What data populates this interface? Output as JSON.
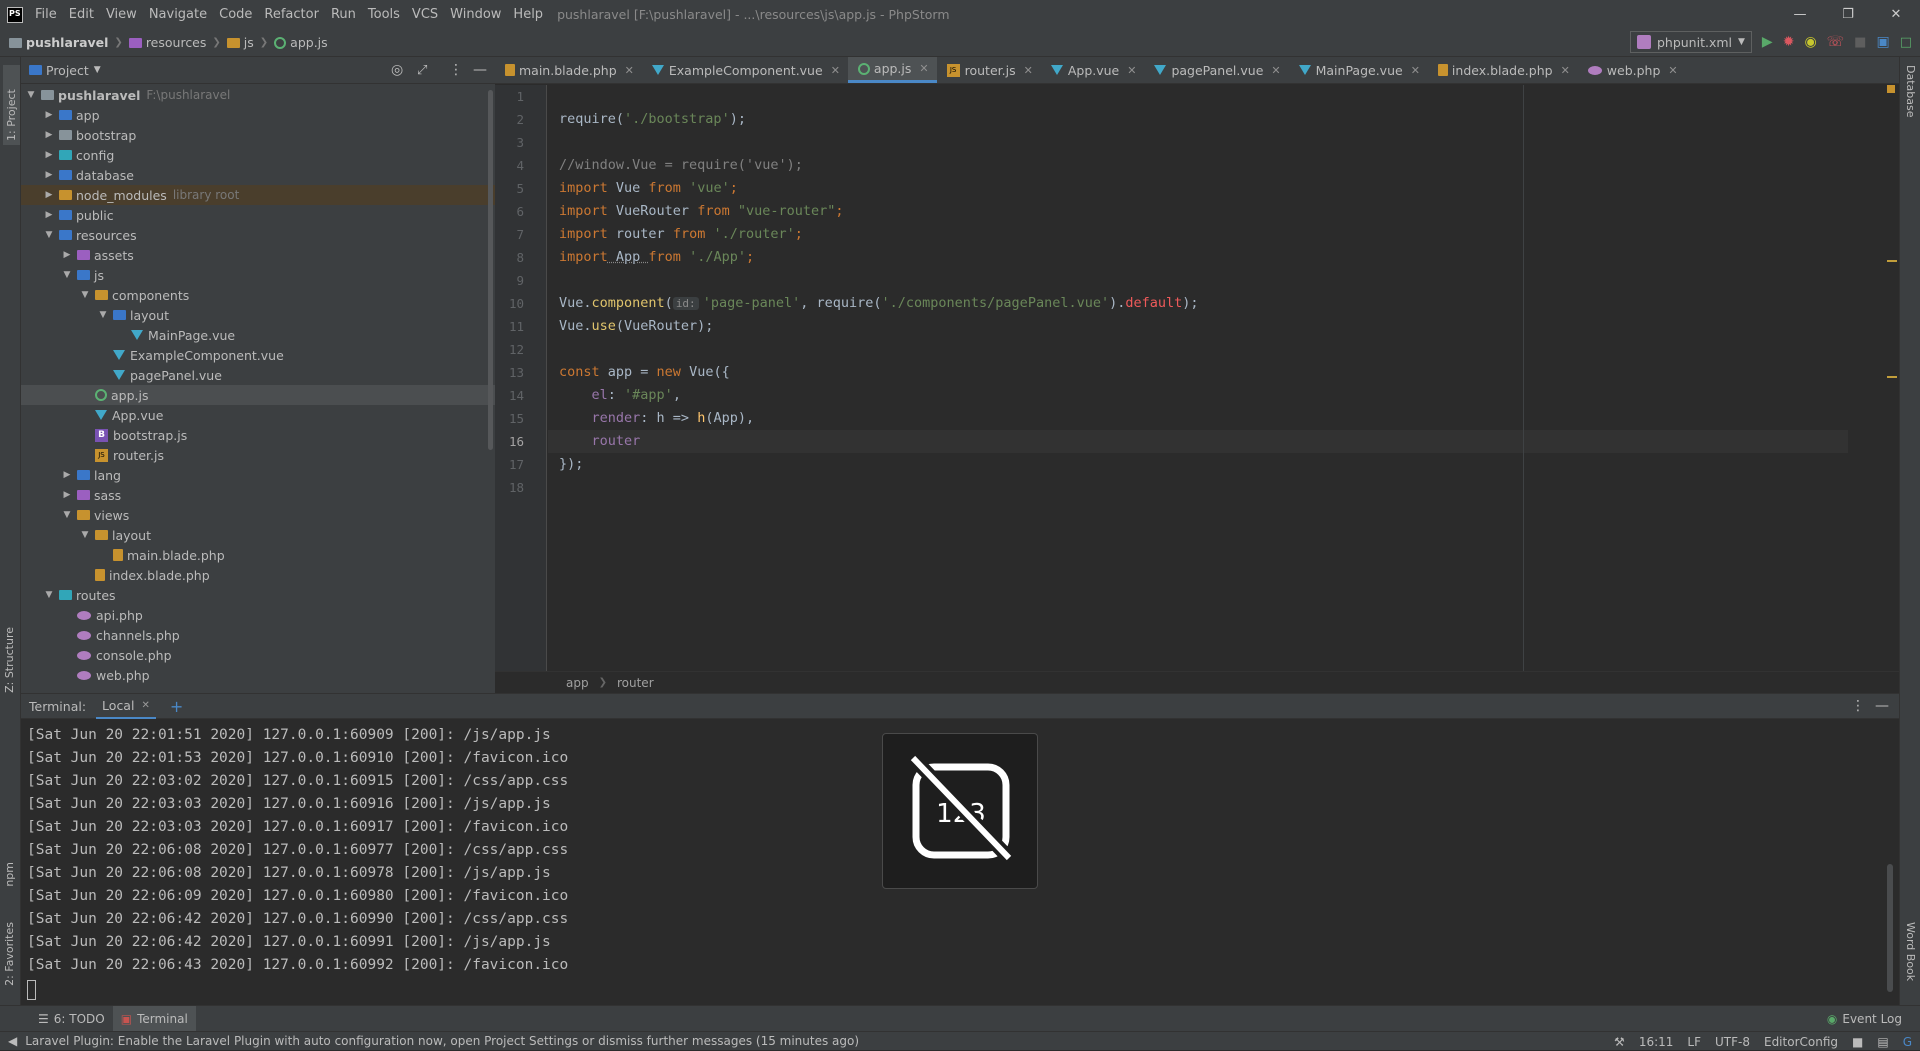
{
  "window": {
    "title": "pushlaravel [F:\\pushlaravel] - ...\\resources\\js\\app.js - PhpStorm",
    "menu": [
      "File",
      "Edit",
      "View",
      "Navigate",
      "Code",
      "Refactor",
      "Run",
      "Tools",
      "VCS",
      "Window",
      "Help"
    ]
  },
  "breadcrumbs": [
    "pushlaravel",
    "resources",
    "js",
    "app.js"
  ],
  "toolbar": {
    "run_config": "phpunit.xml"
  },
  "left_strip": {
    "project": "1: Project",
    "structure": "Z: Structure",
    "npm": "npm",
    "favorites": "2: Favorites"
  },
  "right_strip": {
    "database": "Database",
    "wordbook": "Word Book"
  },
  "project_panel": {
    "title": "Project",
    "tree": [
      {
        "label": "pushlaravel",
        "hint": "F:\\pushlaravel",
        "depth": 0,
        "arrow": "down",
        "icon": "folder"
      },
      {
        "label": "app",
        "depth": 1,
        "arrow": "right",
        "icon": "folder-blue"
      },
      {
        "label": "bootstrap",
        "depth": 1,
        "arrow": "right",
        "icon": "folder"
      },
      {
        "label": "config",
        "depth": 1,
        "arrow": "right",
        "icon": "folder-teal"
      },
      {
        "label": "database",
        "depth": 1,
        "arrow": "right",
        "icon": "folder-blue"
      },
      {
        "label": "node_modules",
        "hint": "library root",
        "depth": 1,
        "arrow": "right",
        "icon": "folder-orange",
        "nm": true
      },
      {
        "label": "public",
        "depth": 1,
        "arrow": "right",
        "icon": "folder-blue"
      },
      {
        "label": "resources",
        "depth": 1,
        "arrow": "down",
        "icon": "folder-blue"
      },
      {
        "label": "assets",
        "depth": 2,
        "arrow": "right",
        "icon": "folder-purple"
      },
      {
        "label": "js",
        "depth": 2,
        "arrow": "down",
        "icon": "folder-blue"
      },
      {
        "label": "components",
        "depth": 3,
        "arrow": "down",
        "icon": "folder-orange"
      },
      {
        "label": "layout",
        "depth": 4,
        "arrow": "down",
        "icon": "folder-blue"
      },
      {
        "label": "MainPage.vue",
        "depth": 5,
        "arrow": "",
        "icon": "vue"
      },
      {
        "label": "ExampleComponent.vue",
        "depth": 4,
        "arrow": "",
        "icon": "vue"
      },
      {
        "label": "pagePanel.vue",
        "depth": 4,
        "arrow": "",
        "icon": "vue"
      },
      {
        "label": "app.js",
        "depth": 3,
        "arrow": "",
        "icon": "js",
        "selected": true
      },
      {
        "label": "App.vue",
        "depth": 3,
        "arrow": "",
        "icon": "vue"
      },
      {
        "label": "bootstrap.js",
        "depth": 3,
        "arrow": "",
        "icon": "bootstrap"
      },
      {
        "label": "router.js",
        "depth": 3,
        "arrow": "",
        "icon": "router"
      },
      {
        "label": "lang",
        "depth": 2,
        "arrow": "right",
        "icon": "folder-blue"
      },
      {
        "label": "sass",
        "depth": 2,
        "arrow": "right",
        "icon": "folder-purple"
      },
      {
        "label": "views",
        "depth": 2,
        "arrow": "down",
        "icon": "folder-orange"
      },
      {
        "label": "layout",
        "depth": 3,
        "arrow": "down",
        "icon": "folder-orange"
      },
      {
        "label": "main.blade.php",
        "depth": 4,
        "arrow": "",
        "icon": "blade"
      },
      {
        "label": "index.blade.php",
        "depth": 3,
        "arrow": "",
        "icon": "blade"
      },
      {
        "label": "routes",
        "depth": 1,
        "arrow": "down",
        "icon": "folder-teal"
      },
      {
        "label": "api.php",
        "depth": 2,
        "arrow": "",
        "icon": "php"
      },
      {
        "label": "channels.php",
        "depth": 2,
        "arrow": "",
        "icon": "php"
      },
      {
        "label": "console.php",
        "depth": 2,
        "arrow": "",
        "icon": "php"
      },
      {
        "label": "web.php",
        "depth": 2,
        "arrow": "",
        "icon": "php"
      }
    ]
  },
  "editor": {
    "tabs": [
      {
        "label": "main.blade.php",
        "icon": "blade"
      },
      {
        "label": "ExampleComponent.vue",
        "icon": "vue"
      },
      {
        "label": "app.js",
        "icon": "js",
        "active": true
      },
      {
        "label": "router.js",
        "icon": "router"
      },
      {
        "label": "App.vue",
        "icon": "vue"
      },
      {
        "label": "pagePanel.vue",
        "icon": "vue"
      },
      {
        "label": "MainPage.vue",
        "icon": "vue"
      },
      {
        "label": "index.blade.php",
        "icon": "blade"
      },
      {
        "label": "web.php",
        "icon": "php"
      }
    ],
    "line_numbers": [
      "1",
      "2",
      "3",
      "4",
      "5",
      "6",
      "7",
      "8",
      "9",
      "10",
      "11",
      "12",
      "13",
      "14",
      "15",
      "16",
      "17",
      "18"
    ],
    "current_line": 16,
    "code": {
      "l2a": "require(",
      "l2b": "'./bootstrap'",
      "l2c": ");",
      "l4": "//window.Vue = require('vue');",
      "l5a": "import",
      "l5b": " Vue ",
      "l5c": "from",
      "l5d": " 'vue'",
      "l5e": ";",
      "l6a": "import",
      "l6b": " VueRouter ",
      "l6c": "from",
      "l6d": " \"vue-router\"",
      "l6e": ";",
      "l7a": "import",
      "l7b": " router ",
      "l7c": "from",
      "l7d": " './router'",
      "l7e": ";",
      "l8a": "import",
      "l8b": " App ",
      "l8c": "from",
      "l8d": " './App'",
      "l8e": ";",
      "l10a": "Vue.",
      "l10b": "component",
      "l10c": "(",
      "l10hint": "id:",
      "l10d": "'page-panel'",
      "l10e": ", require(",
      "l10f": "'./components/pagePanel.vue'",
      "l10g": ").",
      "l10h": "default",
      "l10i": ");",
      "l11a": "Vue.",
      "l11b": "use",
      "l11c": "(VueRouter);",
      "l13a": "const",
      "l13b": " app = ",
      "l13c": "new",
      "l13d": " Vue({",
      "l14a": "    el",
      "l14b": ": ",
      "l14c": "'#app'",
      "l14d": ",",
      "l15a": "    render",
      "l15b": ": h => ",
      "l15c": "h",
      "l15d": "(App),",
      "l16": "    router",
      "l17": "});"
    },
    "breadcrumb": [
      "app",
      "router"
    ]
  },
  "terminal": {
    "label": "Terminal:",
    "tab": "Local",
    "lines": [
      "[Sat Jun 20 22:01:51 2020] 127.0.0.1:60909 [200]: /js/app.js",
      "[Sat Jun 20 22:01:53 2020] 127.0.0.1:60910 [200]: /favicon.ico",
      "[Sat Jun 20 22:03:02 2020] 127.0.0.1:60915 [200]: /css/app.css",
      "[Sat Jun 20 22:03:03 2020] 127.0.0.1:60916 [200]: /js/app.js",
      "[Sat Jun 20 22:03:03 2020] 127.0.0.1:60917 [200]: /favicon.ico",
      "[Sat Jun 20 22:06:08 2020] 127.0.0.1:60977 [200]: /css/app.css",
      "[Sat Jun 20 22:06:08 2020] 127.0.0.1:60978 [200]: /js/app.js",
      "[Sat Jun 20 22:06:09 2020] 127.0.0.1:60980 [200]: /favicon.ico",
      "[Sat Jun 20 22:06:42 2020] 127.0.0.1:60990 [200]: /css/app.css",
      "[Sat Jun 20 22:06:42 2020] 127.0.0.1:60991 [200]: /js/app.js",
      "[Sat Jun 20 22:06:43 2020] 127.0.0.1:60992 [200]: /favicon.ico"
    ],
    "overlay_text": "123"
  },
  "bottom_tabs": {
    "todo": "6: TODO",
    "terminal": "Terminal",
    "event_log": "Event Log"
  },
  "status": {
    "message": "Laravel Plugin: Enable the Laravel Plugin with auto configuration now, open Project Settings or dismiss further messages (15 minutes ago)",
    "position": "16:11",
    "line_sep": "LF",
    "encoding": "UTF-8",
    "editorconfig": "EditorConfig"
  },
  "colors": {
    "accent": "#4a88c7",
    "keyword": "#cc7832",
    "string": "#6a8759",
    "comment": "#808080",
    "function": "#ffc66d",
    "background": "#2b2b2b",
    "panel": "#3c3f41"
  }
}
